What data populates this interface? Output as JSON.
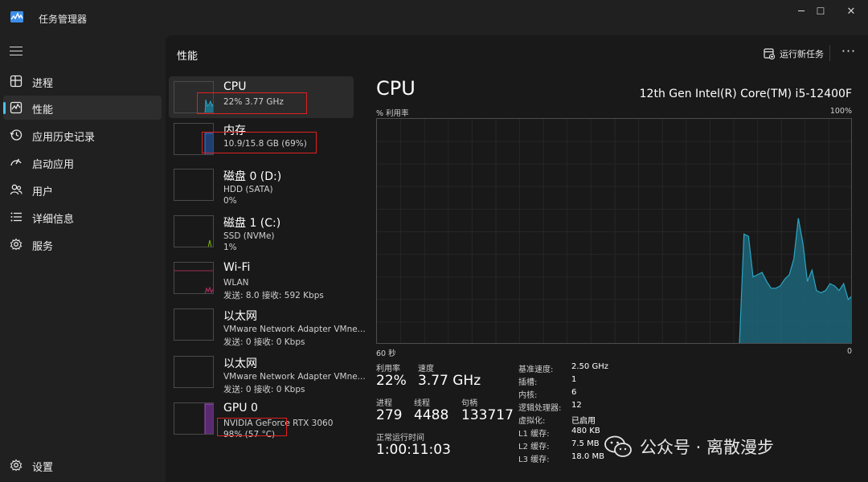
{
  "window": {
    "title": "任务管理器",
    "controls": {
      "minimize": "─",
      "maximize": "☐",
      "close": "✕"
    }
  },
  "sidebar": {
    "menu_icon": "hamburger-icon",
    "items": [
      {
        "label": "进程",
        "icon": "processes-icon",
        "active": false
      },
      {
        "label": "性能",
        "icon": "performance-icon",
        "active": true
      },
      {
        "label": "应用历史记录",
        "icon": "history-icon",
        "active": false
      },
      {
        "label": "启动应用",
        "icon": "startup-icon",
        "active": false
      },
      {
        "label": "用户",
        "icon": "users-icon",
        "active": false
      },
      {
        "label": "详细信息",
        "icon": "details-icon",
        "active": false
      },
      {
        "label": "服务",
        "icon": "services-icon",
        "active": false
      }
    ],
    "settings_label": "设置"
  },
  "header": {
    "title": "性能",
    "run_task_label": "运行新任务",
    "more_label": "···"
  },
  "resources": [
    {
      "name": "CPU",
      "sub": "22%  3.77 GHz",
      "sub2": "",
      "color": "#2aa6c4",
      "active": true
    },
    {
      "name": "内存",
      "sub": "10.9/15.8 GB (69%)",
      "sub2": "",
      "color": "#3a78d8",
      "active": false
    },
    {
      "name": "磁盘 0 (D:)",
      "sub": "HDD (SATA)",
      "sub2": "0%",
      "color": "#7fb800",
      "active": false
    },
    {
      "name": "磁盘 1 (C:)",
      "sub": "SSD (NVMe)",
      "sub2": "1%",
      "color": "#7fb800",
      "active": false
    },
    {
      "name": "Wi-Fi",
      "sub": "WLAN",
      "sub2": "发送: 8.0  接收: 592 Kbps",
      "color": "#c0306a",
      "active": false
    },
    {
      "name": "以太网",
      "sub": "VMware Network Adapter VMne...",
      "sub2": "发送: 0  接收: 0 Kbps",
      "color": "#c0306a",
      "active": false
    },
    {
      "name": "以太网",
      "sub": "VMware Network Adapter VMne...",
      "sub2": "发送: 0  接收: 0 Kbps",
      "color": "#c0306a",
      "active": false
    },
    {
      "name": "GPU 0",
      "sub": "NVIDIA GeForce RTX 3060",
      "sub2": "98%  (57 °C)",
      "color": "#a04cc0",
      "active": false
    }
  ],
  "detail": {
    "title": "CPU",
    "model": "12th Gen Intel(R) Core(TM) i5-12400F",
    "graph_top_left": "% 利用率",
    "graph_top_right": "100%",
    "graph_bottom_left": "60 秒",
    "graph_bottom_right": "0",
    "utilization_series": [
      0,
      0,
      0,
      0,
      0,
      0,
      0,
      0,
      0,
      0,
      0,
      0,
      0,
      0,
      0,
      0,
      0,
      0,
      0,
      0,
      0,
      0,
      0,
      0,
      0,
      0,
      0,
      0,
      0,
      0,
      0,
      0,
      0,
      0,
      0,
      0,
      0,
      0,
      0,
      0,
      0,
      0,
      0,
      0,
      0,
      0,
      0,
      0,
      0,
      0,
      0,
      0,
      0,
      0,
      0,
      0,
      0,
      0,
      0,
      0,
      0,
      0,
      0,
      0,
      0,
      0,
      0,
      0,
      0,
      0,
      0,
      0,
      0,
      0,
      0,
      0,
      0,
      0,
      0,
      0,
      0,
      49,
      48,
      30,
      31,
      32,
      28,
      25,
      25,
      26,
      29,
      31,
      38,
      56,
      45,
      28,
      33,
      24,
      23,
      24,
      27,
      26,
      24,
      27,
      20,
      22
    ],
    "graph_color": "#1d6f86",
    "stats": {
      "utilization_label": "利用率",
      "utilization": "22%",
      "speed_label": "速度",
      "speed": "3.77 GHz",
      "processes_label": "进程",
      "processes": "279",
      "threads_label": "线程",
      "threads": "4488",
      "handles_label": "句柄",
      "handles": "133717",
      "uptime_label": "正常运行时间",
      "uptime": "1:00:11:03"
    },
    "specs": [
      {
        "k": "基准速度:",
        "v": "2.50 GHz"
      },
      {
        "k": "插槽:",
        "v": "1"
      },
      {
        "k": "内核:",
        "v": "6"
      },
      {
        "k": "逻辑处理器:",
        "v": "12"
      },
      {
        "k": "虚拟化:",
        "v": "已启用"
      },
      {
        "k": "L1 缓存:",
        "v": "480 KB"
      },
      {
        "k": "L2 缓存:",
        "v": "7.5 MB"
      },
      {
        "k": "L3 缓存:",
        "v": "18.0 MB"
      }
    ]
  },
  "watermark": {
    "text": "公众号 · 离散漫步",
    "icon": "wechat-icon"
  }
}
